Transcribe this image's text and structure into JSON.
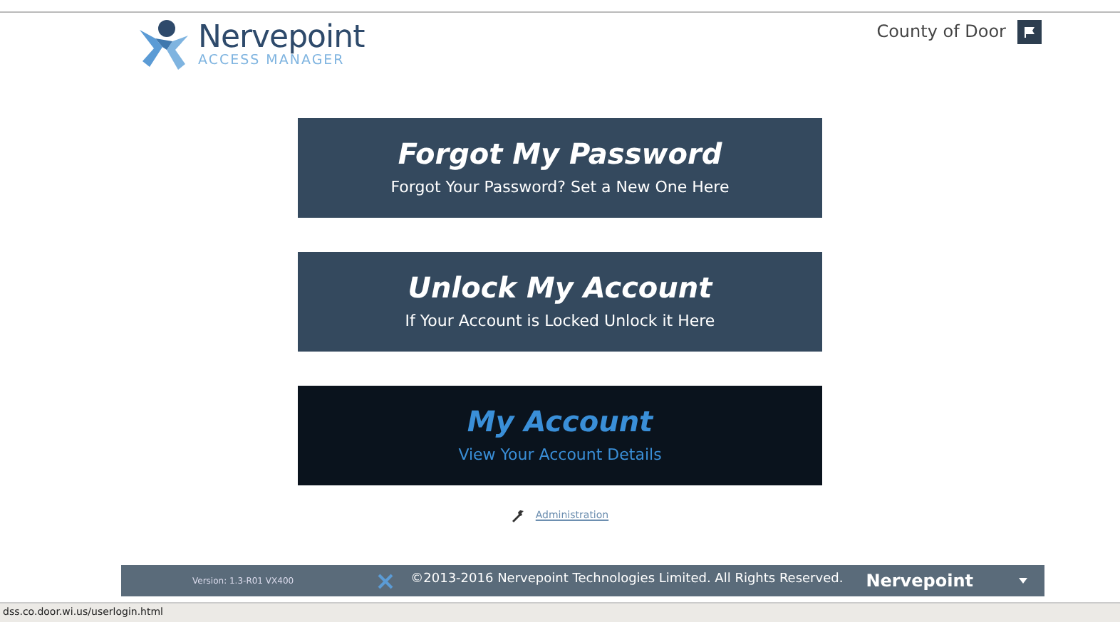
{
  "header": {
    "logo": {
      "name": "Nervepoint",
      "subtitle": "ACCESS MANAGER"
    },
    "organization": "County of Door"
  },
  "tiles": [
    {
      "title": "Forgot My Password",
      "subtitle": "Forgot Your Password? Set a New One Here",
      "selected": false
    },
    {
      "title": "Unlock My Account",
      "subtitle": "If Your Account is Locked Unlock it Here",
      "selected": false
    },
    {
      "title": "My Account",
      "subtitle": "View Your Account Details",
      "selected": true
    }
  ],
  "admin_link": "Administration",
  "footer": {
    "version": "Version: 1.3-R01  VX400",
    "copyright": "©2013-2016 Nervepoint Technologies Limited. All Rights Reserved.",
    "brand": "Nervepoint"
  },
  "status_bar": "dss.co.door.wi.us/userlogin.html"
}
